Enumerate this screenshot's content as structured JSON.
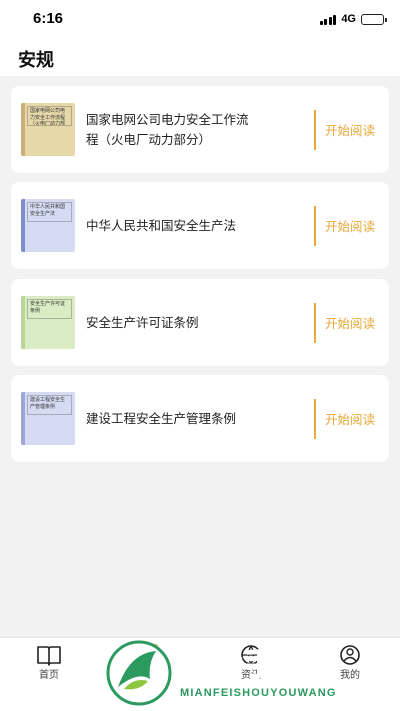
{
  "status_bar": {
    "time": "6:16",
    "network": "4G"
  },
  "header": {
    "title": "安规"
  },
  "books": [
    {
      "title": "国家电网公司电力安全工作流程（火电厂动力部分）",
      "cover_text": "国家电网公司电力安全工作流程（火电厂动力部分）",
      "cover_color": "#e6d8a8",
      "spine_color": "#c9b27a",
      "action": "开始阅读"
    },
    {
      "title": "中华人民共和国安全生产法",
      "cover_text": "中华人民共和国安全生产法",
      "cover_color": "#d5dbf2",
      "spine_color": "#7d8fd0",
      "action": "开始阅读"
    },
    {
      "title": "安全生产许可证条例",
      "cover_text": "安全生产许可证条例",
      "cover_color": "#d9ecc4",
      "spine_color": "#b9d898",
      "action": "开始阅读"
    },
    {
      "title": "建设工程安全生产管理条例",
      "cover_text": "建设工程安全生产管理条例",
      "cover_color": "#d5dbf2",
      "spine_color": "#9aa7d8",
      "action": "开始阅读"
    }
  ],
  "accent_color": "#e7a83a",
  "tab_bar": {
    "tabs": [
      {
        "label": "首页",
        "icon": "book-open-icon"
      },
      {
        "label": "",
        "icon": "document-icon"
      },
      {
        "label": "资讯",
        "icon": "globe-icon"
      },
      {
        "label": "我的",
        "icon": "user-icon"
      }
    ]
  },
  "watermark": {
    "title": "免费手游网",
    "subtitle": "MIANFEISHOUYOUWANG"
  }
}
